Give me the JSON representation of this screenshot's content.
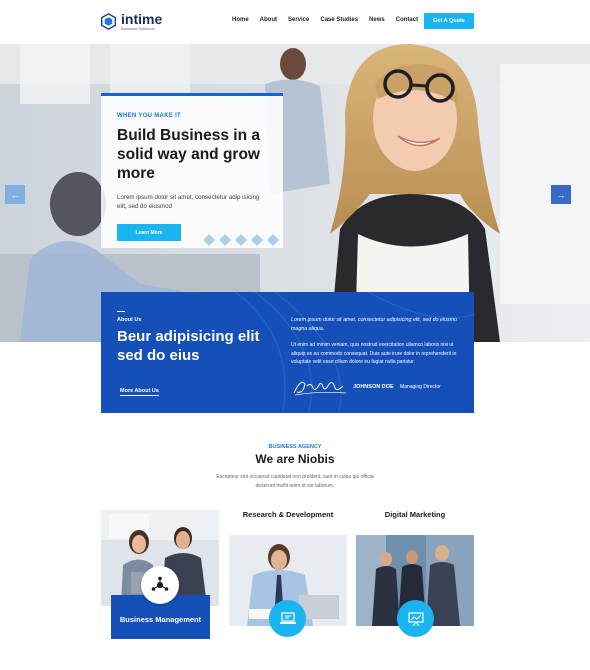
{
  "brand": {
    "name": "intime",
    "tagline": "Business Solutions"
  },
  "nav": {
    "items": [
      "Home",
      "About",
      "Service",
      "Case Studies",
      "News",
      "Contact"
    ],
    "cta": "Get A Quote"
  },
  "hero": {
    "eyebrow": "WHEN YOU MAKE IT",
    "title": "Build Business in a solid way and grow more",
    "description": "Lorem ipsum dolor sit amet, consectetur adip isicing elit, sed do eiusmod",
    "button": "Learn More",
    "arrow_left": "←",
    "arrow_right": "→"
  },
  "about": {
    "label": "About Us",
    "title": "Beur adipisicing elit sed do eius",
    "link": "More About Us",
    "paragraph1": "Lorem ipsum dolor sit amet, consectetur adipisicing elit, sed do eiusmo magna aliqua.",
    "paragraph2": "Ut enim ad minim veniam, quis nostrud exercitation ullamco laboris nisi ut aliquip ex ea commodo consequat. Duis aute irure dolor in reprehenderit in voluptate velit esse cillum dolore eu fugiat nulla pariatur.",
    "signer_name": "JOHNSON DOE",
    "signer_role": "Managing Director"
  },
  "intro": {
    "eyebrow": "BUSINESS AGENCY",
    "title": "We are Niobis",
    "description": "Excepteur sint occaecat cupidatat non proident, sunt in culpa qui officia deserunt mollit anim id est laborum."
  },
  "services": [
    {
      "title": "Business Management",
      "icon": "network-icon"
    },
    {
      "title": "Research & Development",
      "icon": "laptop-icon"
    },
    {
      "title": "Digital Marketing",
      "icon": "presentation-icon"
    }
  ],
  "colors": {
    "primary": "#1450b8",
    "accent": "#1ab5f0",
    "text": "#1a1a1a"
  }
}
